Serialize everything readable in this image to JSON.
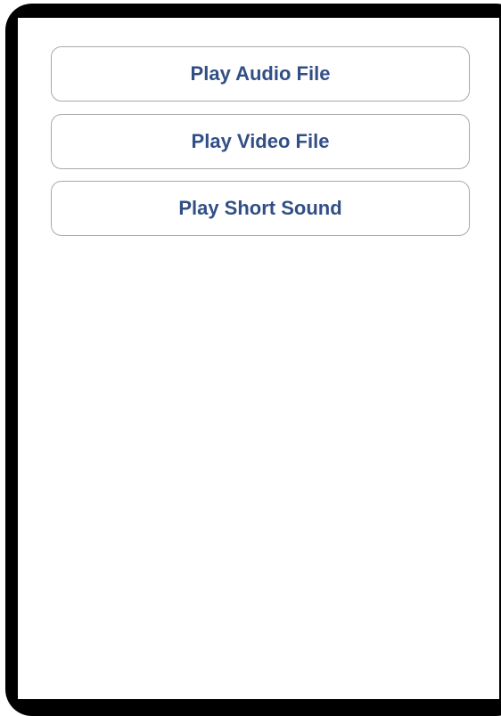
{
  "buttons": {
    "play_audio": "Play Audio File",
    "play_video": "Play Video File",
    "play_sound": "Play Short Sound"
  },
  "colors": {
    "frame": "#000000",
    "screen_background": "#ffffff",
    "button_text": "#324f85",
    "button_border": "#a9a9a9"
  }
}
